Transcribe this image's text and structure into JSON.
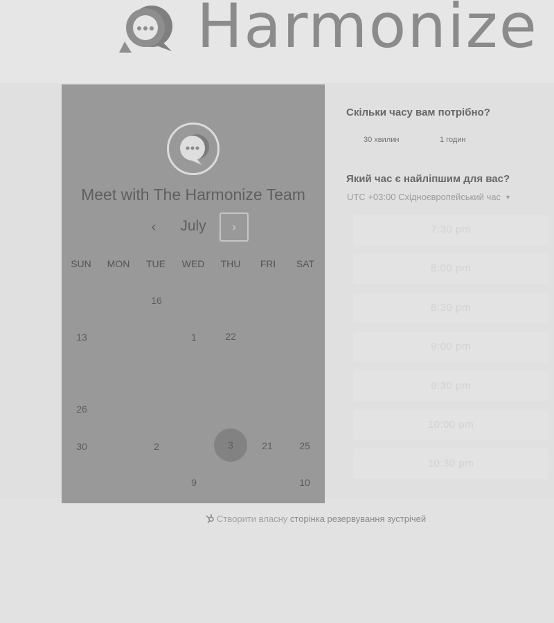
{
  "brand": {
    "name": "Harmonize"
  },
  "panel": {
    "title": "Meet with The Harmonize Team",
    "month": "July",
    "prev_icon": "‹",
    "next_icon": "›",
    "weekdays": [
      "SUN",
      "MON",
      "TUE",
      "WED",
      "THU",
      "FRI",
      "SAT"
    ],
    "days": [
      "16",
      "13",
      "1",
      "22",
      "26",
      "30",
      "2",
      "3",
      "21",
      "25",
      "9",
      "10"
    ],
    "selected_day": "3"
  },
  "duration": {
    "question": "Скільки часу вам потрібно?",
    "options": [
      "30 хвилин",
      "1 годин"
    ]
  },
  "time": {
    "question": "Який час є найліпшим для вас?",
    "timezone": "UTC +03:00 Східноєвропейський час",
    "slots": [
      "7:30 pm",
      "8:00 pm",
      "8:30 pm",
      "9:00 pm",
      "9:30 pm",
      "10:00 pm",
      "10:30 pm"
    ]
  },
  "footer": {
    "prefix": "Створити власну",
    "link": "сторінка резервування зустрічей"
  },
  "colors": {
    "background": "#e2e2e2",
    "panel": "#999999",
    "selected_day": "#828282",
    "logo": "#8b8b8b"
  }
}
